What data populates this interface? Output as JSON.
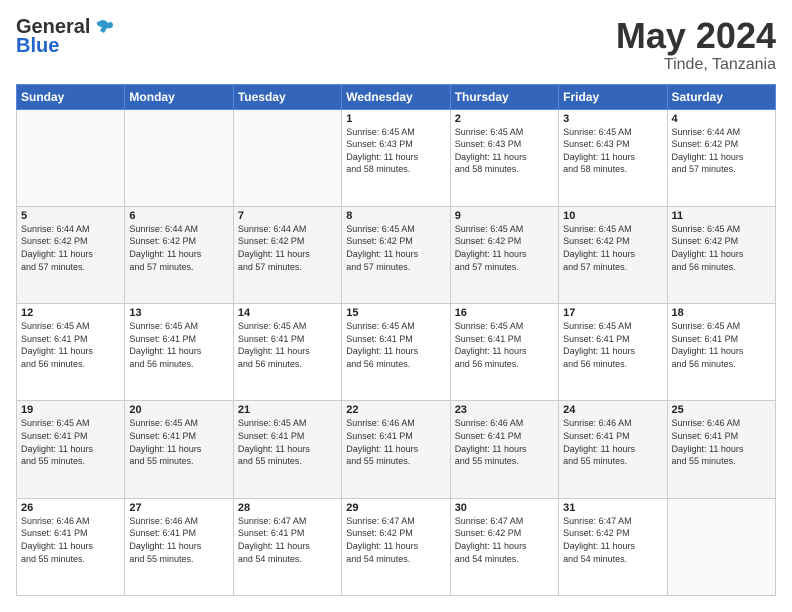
{
  "header": {
    "logo_general": "General",
    "logo_blue": "Blue",
    "month": "May 2024",
    "location": "Tinde, Tanzania"
  },
  "weekdays": [
    "Sunday",
    "Monday",
    "Tuesday",
    "Wednesday",
    "Thursday",
    "Friday",
    "Saturday"
  ],
  "weeks": [
    [
      {
        "day": "",
        "info": ""
      },
      {
        "day": "",
        "info": ""
      },
      {
        "day": "",
        "info": ""
      },
      {
        "day": "1",
        "info": "Sunrise: 6:45 AM\nSunset: 6:43 PM\nDaylight: 11 hours\nand 58 minutes."
      },
      {
        "day": "2",
        "info": "Sunrise: 6:45 AM\nSunset: 6:43 PM\nDaylight: 11 hours\nand 58 minutes."
      },
      {
        "day": "3",
        "info": "Sunrise: 6:45 AM\nSunset: 6:43 PM\nDaylight: 11 hours\nand 58 minutes."
      },
      {
        "day": "4",
        "info": "Sunrise: 6:44 AM\nSunset: 6:42 PM\nDaylight: 11 hours\nand 57 minutes."
      }
    ],
    [
      {
        "day": "5",
        "info": "Sunrise: 6:44 AM\nSunset: 6:42 PM\nDaylight: 11 hours\nand 57 minutes."
      },
      {
        "day": "6",
        "info": "Sunrise: 6:44 AM\nSunset: 6:42 PM\nDaylight: 11 hours\nand 57 minutes."
      },
      {
        "day": "7",
        "info": "Sunrise: 6:44 AM\nSunset: 6:42 PM\nDaylight: 11 hours\nand 57 minutes."
      },
      {
        "day": "8",
        "info": "Sunrise: 6:45 AM\nSunset: 6:42 PM\nDaylight: 11 hours\nand 57 minutes."
      },
      {
        "day": "9",
        "info": "Sunrise: 6:45 AM\nSunset: 6:42 PM\nDaylight: 11 hours\nand 57 minutes."
      },
      {
        "day": "10",
        "info": "Sunrise: 6:45 AM\nSunset: 6:42 PM\nDaylight: 11 hours\nand 57 minutes."
      },
      {
        "day": "11",
        "info": "Sunrise: 6:45 AM\nSunset: 6:42 PM\nDaylight: 11 hours\nand 56 minutes."
      }
    ],
    [
      {
        "day": "12",
        "info": "Sunrise: 6:45 AM\nSunset: 6:41 PM\nDaylight: 11 hours\nand 56 minutes."
      },
      {
        "day": "13",
        "info": "Sunrise: 6:45 AM\nSunset: 6:41 PM\nDaylight: 11 hours\nand 56 minutes."
      },
      {
        "day": "14",
        "info": "Sunrise: 6:45 AM\nSunset: 6:41 PM\nDaylight: 11 hours\nand 56 minutes."
      },
      {
        "day": "15",
        "info": "Sunrise: 6:45 AM\nSunset: 6:41 PM\nDaylight: 11 hours\nand 56 minutes."
      },
      {
        "day": "16",
        "info": "Sunrise: 6:45 AM\nSunset: 6:41 PM\nDaylight: 11 hours\nand 56 minutes."
      },
      {
        "day": "17",
        "info": "Sunrise: 6:45 AM\nSunset: 6:41 PM\nDaylight: 11 hours\nand 56 minutes."
      },
      {
        "day": "18",
        "info": "Sunrise: 6:45 AM\nSunset: 6:41 PM\nDaylight: 11 hours\nand 56 minutes."
      }
    ],
    [
      {
        "day": "19",
        "info": "Sunrise: 6:45 AM\nSunset: 6:41 PM\nDaylight: 11 hours\nand 55 minutes."
      },
      {
        "day": "20",
        "info": "Sunrise: 6:45 AM\nSunset: 6:41 PM\nDaylight: 11 hours\nand 55 minutes."
      },
      {
        "day": "21",
        "info": "Sunrise: 6:45 AM\nSunset: 6:41 PM\nDaylight: 11 hours\nand 55 minutes."
      },
      {
        "day": "22",
        "info": "Sunrise: 6:46 AM\nSunset: 6:41 PM\nDaylight: 11 hours\nand 55 minutes."
      },
      {
        "day": "23",
        "info": "Sunrise: 6:46 AM\nSunset: 6:41 PM\nDaylight: 11 hours\nand 55 minutes."
      },
      {
        "day": "24",
        "info": "Sunrise: 6:46 AM\nSunset: 6:41 PM\nDaylight: 11 hours\nand 55 minutes."
      },
      {
        "day": "25",
        "info": "Sunrise: 6:46 AM\nSunset: 6:41 PM\nDaylight: 11 hours\nand 55 minutes."
      }
    ],
    [
      {
        "day": "26",
        "info": "Sunrise: 6:46 AM\nSunset: 6:41 PM\nDaylight: 11 hours\nand 55 minutes."
      },
      {
        "day": "27",
        "info": "Sunrise: 6:46 AM\nSunset: 6:41 PM\nDaylight: 11 hours\nand 55 minutes."
      },
      {
        "day": "28",
        "info": "Sunrise: 6:47 AM\nSunset: 6:41 PM\nDaylight: 11 hours\nand 54 minutes."
      },
      {
        "day": "29",
        "info": "Sunrise: 6:47 AM\nSunset: 6:42 PM\nDaylight: 11 hours\nand 54 minutes."
      },
      {
        "day": "30",
        "info": "Sunrise: 6:47 AM\nSunset: 6:42 PM\nDaylight: 11 hours\nand 54 minutes."
      },
      {
        "day": "31",
        "info": "Sunrise: 6:47 AM\nSunset: 6:42 PM\nDaylight: 11 hours\nand 54 minutes."
      },
      {
        "day": "",
        "info": ""
      }
    ]
  ]
}
